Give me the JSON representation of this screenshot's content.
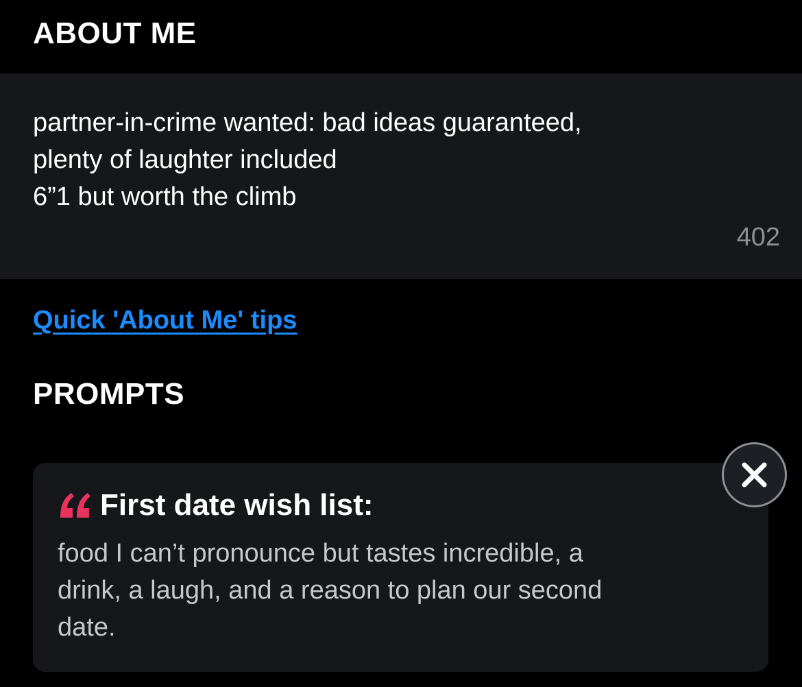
{
  "about": {
    "title": "ABOUT ME",
    "lines": [
      "partner-in-crime wanted: bad ideas guaranteed,",
      "plenty of laughter included",
      "6”1 but worth the climb"
    ],
    "char_count": "402",
    "tips_link": "Quick 'About Me' tips"
  },
  "prompts": {
    "title": "PROMPTS",
    "items": [
      {
        "question": "First date wish list:",
        "answer_lines": [
          "food I can’t pronounce but tastes incredible, a",
          "drink, a laugh, and a reason to plan our second",
          "date."
        ],
        "quote_icon": "quote-icon",
        "remove_icon": "close-icon"
      }
    ]
  },
  "colors": {
    "background": "#000000",
    "card": "#15171b",
    "link": "#1a8cff",
    "quote_accent": "#e8345d",
    "muted_text": "#8e8e93",
    "answer_text": "#c7c7cc"
  }
}
